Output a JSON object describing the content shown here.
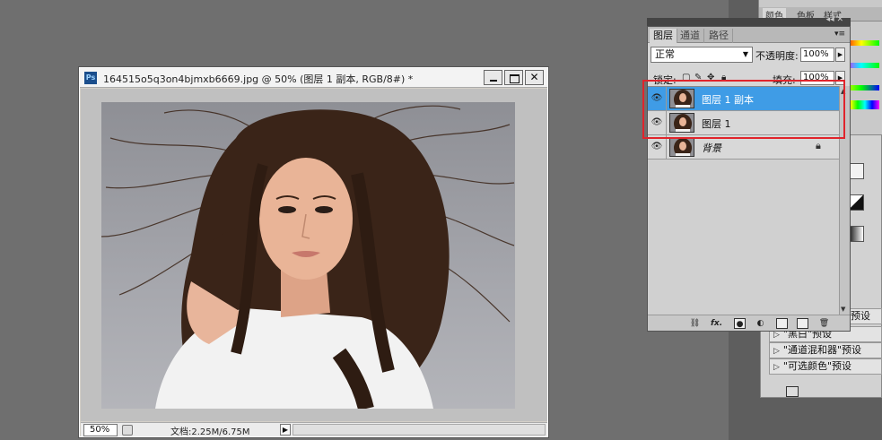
{
  "document": {
    "title": "164515o5q3on4bjmxb6669.jpg @ 50% (图层 1 副本, RGB/8#) *",
    "app_icon": "Ps",
    "zoom": "50%",
    "doc_info": "文档:2.25M/6.75M",
    "window_buttons": {
      "minimize": "minimize-icon",
      "maximize": "maximize-icon",
      "close": "✕"
    }
  },
  "layers_panel": {
    "tabs": [
      {
        "label": "图层",
        "active": true
      },
      {
        "label": "通道",
        "active": false
      },
      {
        "label": "路径",
        "active": false
      }
    ],
    "blend_mode": "正常",
    "opacity_label": "不透明度:",
    "opacity_value": "100%",
    "lock_label": "锁定:",
    "fill_label": "填充:",
    "fill_value": "100%",
    "layers": [
      {
        "name": "图层 1 副本",
        "selected": true,
        "italic": false
      },
      {
        "name": "图层 1",
        "selected": false,
        "italic": false
      },
      {
        "name": "背景",
        "selected": false,
        "italic": true
      }
    ],
    "footer_icons": [
      "link-icon",
      "fx-icon",
      "mask-icon",
      "adjustment-icon",
      "group-icon",
      "new-layer-icon",
      "trash-icon"
    ],
    "footer_fx": "fx."
  },
  "right_panel": {
    "tabs": [
      "颜色",
      "色板",
      "样式"
    ],
    "presets": [
      {
        "label": "\"黑白\"预设"
      },
      {
        "label": "\"通道混和器\"预设"
      },
      {
        "label": "\"可选颜色\"预设"
      }
    ],
    "partial_preset_label": "预设"
  },
  "colors": {
    "selection": "#3f9ce6",
    "highlight": "#e0242c",
    "workspace": "#6f6f6f"
  }
}
